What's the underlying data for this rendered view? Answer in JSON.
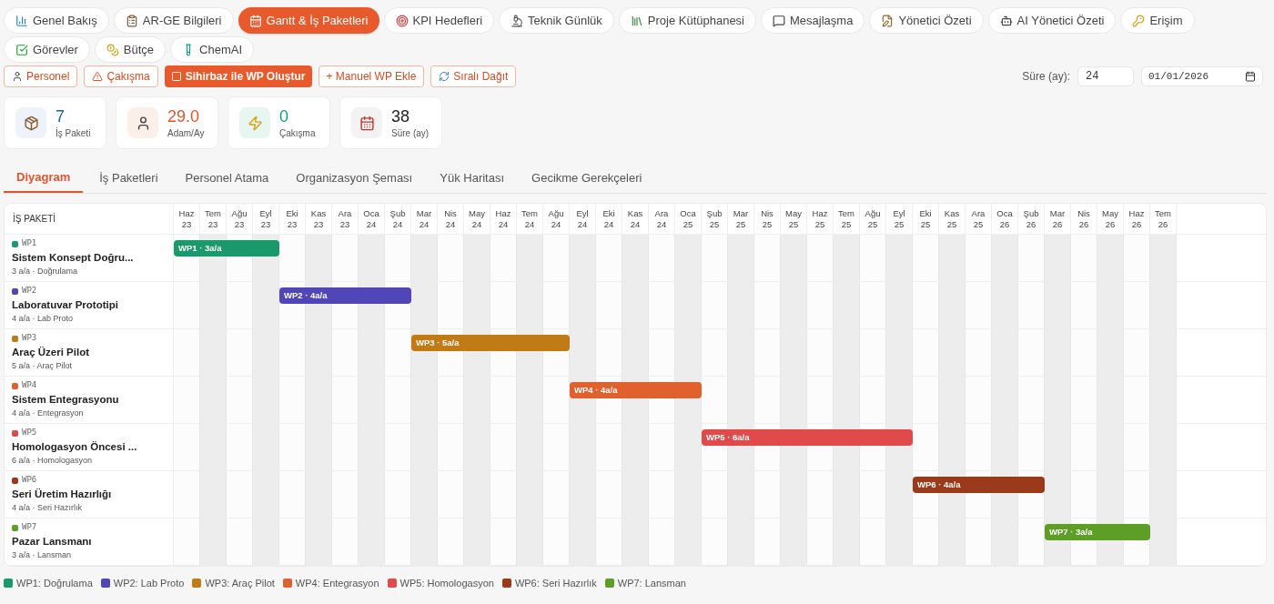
{
  "nav_tabs": [
    {
      "label": "Genel Bakış",
      "selected": false
    },
    {
      "label": "AR-GE Bilgileri",
      "selected": false
    },
    {
      "label": "Gantt & İş Paketleri",
      "selected": true
    },
    {
      "label": "KPI Hedefleri",
      "selected": false
    },
    {
      "label": "Teknik Günlük",
      "selected": false
    },
    {
      "label": "Proje Kütüphanesi",
      "selected": false
    },
    {
      "label": "Mesajlaşma",
      "selected": false
    },
    {
      "label": "Yönetici Özeti",
      "selected": false
    },
    {
      "label": "AI Yönetici Özeti",
      "selected": false
    },
    {
      "label": "Erişim",
      "selected": false
    },
    {
      "label": "Görevler",
      "selected": false
    },
    {
      "label": "Bütçe",
      "selected": false
    },
    {
      "label": "ChemAI",
      "selected": false
    }
  ],
  "actions": [
    {
      "label": "Personel",
      "kind": "outline"
    },
    {
      "label": "Çakışma",
      "kind": "outline"
    },
    {
      "label": "Sihirbaz ile WP Oluştur",
      "kind": "primary"
    },
    {
      "label": "+ Manuel WP Ekle",
      "kind": "outline"
    },
    {
      "label": "Sıralı Dağıt",
      "kind": "outline"
    }
  ],
  "duration_field": {
    "label": "Süre (ay):",
    "value": "24"
  },
  "start_date": {
    "value": "01/01/2026"
  },
  "stats": [
    {
      "value": "7",
      "label": "İş Paketi",
      "color": "#1e5fa8"
    },
    {
      "value": "29.0",
      "label": "Adam/Ay",
      "color": "#e0552b"
    },
    {
      "value": "0",
      "label": "Çakışma",
      "color": "#1a9a7a"
    },
    {
      "value": "38",
      "label": "Süre (ay)",
      "color": "#222222"
    }
  ],
  "sub_tabs": [
    {
      "label": "Diyagram",
      "selected": true
    },
    {
      "label": "İş Paketleri",
      "selected": false
    },
    {
      "label": "Personel Atama",
      "selected": false
    },
    {
      "label": "Organizasyon Şeması",
      "selected": false
    },
    {
      "label": "Yük Haritası",
      "selected": false
    },
    {
      "label": "Gecikme Gerekçeleri",
      "selected": false
    }
  ],
  "gantt": {
    "column_header": "İŞ PAKETİ",
    "months": [
      [
        "Haz",
        "23"
      ],
      [
        "Tem",
        "23"
      ],
      [
        "Ağu",
        "23"
      ],
      [
        "Eyl",
        "23"
      ],
      [
        "Eki",
        "23"
      ],
      [
        "Kas",
        "23"
      ],
      [
        "Ara",
        "23"
      ],
      [
        "Oca",
        "24"
      ],
      [
        "Şub",
        "24"
      ],
      [
        "Mar",
        "24"
      ],
      [
        "Nis",
        "24"
      ],
      [
        "May",
        "24"
      ],
      [
        "Haz",
        "24"
      ],
      [
        "Tem",
        "24"
      ],
      [
        "Ağu",
        "24"
      ],
      [
        "Eyl",
        "24"
      ],
      [
        "Eki",
        "24"
      ],
      [
        "Kas",
        "24"
      ],
      [
        "Ara",
        "24"
      ],
      [
        "Oca",
        "25"
      ],
      [
        "Şub",
        "25"
      ],
      [
        "Mar",
        "25"
      ],
      [
        "Nis",
        "25"
      ],
      [
        "May",
        "25"
      ],
      [
        "Haz",
        "25"
      ],
      [
        "Tem",
        "25"
      ],
      [
        "Ağu",
        "25"
      ],
      [
        "Eyl",
        "25"
      ],
      [
        "Eki",
        "25"
      ],
      [
        "Kas",
        "25"
      ],
      [
        "Ara",
        "25"
      ],
      [
        "Oca",
        "26"
      ],
      [
        "Şub",
        "26"
      ],
      [
        "Mar",
        "26"
      ],
      [
        "Nis",
        "26"
      ],
      [
        "May",
        "26"
      ],
      [
        "Haz",
        "26"
      ],
      [
        "Tem",
        "26"
      ]
    ],
    "packages": [
      {
        "code": "WP1",
        "title": "Sistem Konsept Doğru...",
        "meta": "3 a/a · Doğrulama",
        "bar": "WP1 · 3a/a",
        "color": "#1a9a6c",
        "active": [
          true,
          true,
          true,
          true,
          false,
          false,
          false,
          false,
          false,
          false,
          false,
          false,
          false,
          false,
          false,
          false,
          false,
          false,
          false,
          false,
          false,
          false,
          false,
          false,
          false,
          false,
          false,
          false,
          false,
          false,
          false,
          false,
          false,
          false,
          false,
          false,
          false,
          false
        ]
      },
      {
        "code": "WP2",
        "title": "Laboratuvar Prototipi",
        "meta": "4 a/a · Lab Proto",
        "bar": "WP2 · 4a/a",
        "color": "#5046b8",
        "active": [
          false,
          false,
          false,
          false,
          true,
          true,
          true,
          true,
          true,
          false,
          false,
          false,
          false,
          false,
          false,
          false,
          false,
          false,
          false,
          false,
          false,
          false,
          false,
          false,
          false,
          false,
          false,
          false,
          false,
          false,
          false,
          false,
          false,
          false,
          false,
          false,
          false,
          false
        ]
      },
      {
        "code": "WP3",
        "title": "Araç Üzeri Pilot",
        "meta": "5 a/a · Araç Pilot",
        "bar": "WP3 · 5a/a",
        "color": "#c07a16",
        "active": [
          false,
          false,
          false,
          false,
          false,
          false,
          false,
          false,
          false,
          true,
          true,
          true,
          true,
          true,
          true,
          false,
          false,
          false,
          false,
          false,
          false,
          false,
          false,
          false,
          false,
          false,
          false,
          false,
          false,
          false,
          false,
          false,
          false,
          false,
          false,
          false,
          false,
          false
        ]
      },
      {
        "code": "WP4",
        "title": "Sistem Entegrasyonu",
        "meta": "4 a/a · Entegrasyon",
        "bar": "WP4 · 4a/a",
        "color": "#e0602e",
        "active": [
          false,
          false,
          false,
          false,
          false,
          false,
          false,
          false,
          false,
          false,
          false,
          false,
          false,
          false,
          false,
          true,
          true,
          true,
          true,
          true,
          false,
          false,
          false,
          false,
          false,
          false,
          false,
          false,
          false,
          false,
          false,
          false,
          false,
          false,
          false,
          false,
          false,
          false
        ]
      },
      {
        "code": "WP5",
        "title": "Homologasyon Öncesi ...",
        "meta": "6 a/a · Homologasyon",
        "bar": "WP5 · 6a/a",
        "color": "#e04a4a",
        "active": [
          false,
          false,
          false,
          false,
          false,
          false,
          false,
          false,
          false,
          false,
          false,
          false,
          false,
          false,
          false,
          false,
          false,
          false,
          false,
          false,
          true,
          true,
          true,
          true,
          true,
          true,
          true,
          true,
          false,
          false,
          false,
          false,
          false,
          false,
          false,
          false,
          false,
          false
        ]
      },
      {
        "code": "WP6",
        "title": "Seri Üretim Hazırlığı",
        "meta": "4 a/a · Seri Hazırlık",
        "bar": "WP6 · 4a/a",
        "color": "#9a3a1a",
        "active": [
          false,
          false,
          false,
          false,
          false,
          false,
          false,
          false,
          false,
          false,
          false,
          false,
          false,
          false,
          false,
          false,
          false,
          false,
          false,
          false,
          false,
          false,
          false,
          false,
          false,
          false,
          false,
          false,
          true,
          true,
          true,
          true,
          true,
          false,
          false,
          false,
          false,
          false
        ]
      },
      {
        "code": "WP7",
        "title": "Pazar Lansmanı",
        "meta": "3 a/a · Lansman",
        "bar": "WP7 · 3a/a",
        "color": "#5e9e26",
        "active": [
          false,
          false,
          false,
          false,
          false,
          false,
          false,
          false,
          false,
          false,
          false,
          false,
          false,
          false,
          false,
          false,
          false,
          false,
          false,
          false,
          false,
          false,
          false,
          false,
          false,
          false,
          false,
          false,
          false,
          false,
          false,
          false,
          false,
          true,
          true,
          true,
          true,
          false
        ]
      }
    ]
  },
  "legend": [
    {
      "label": "WP1: Doğrulama",
      "color": "#1a9a6c"
    },
    {
      "label": "WP2: Lab Proto",
      "color": "#5046b8"
    },
    {
      "label": "WP3: Araç Pilot",
      "color": "#c07a16"
    },
    {
      "label": "WP4: Entegrasyon",
      "color": "#e0602e"
    },
    {
      "label": "WP5: Homologasyon",
      "color": "#e04a4a"
    },
    {
      "label": "WP6: Seri Hazırlık",
      "color": "#9a3a1a"
    },
    {
      "label": "WP7: Lansman",
      "color": "#5e9e26"
    }
  ]
}
